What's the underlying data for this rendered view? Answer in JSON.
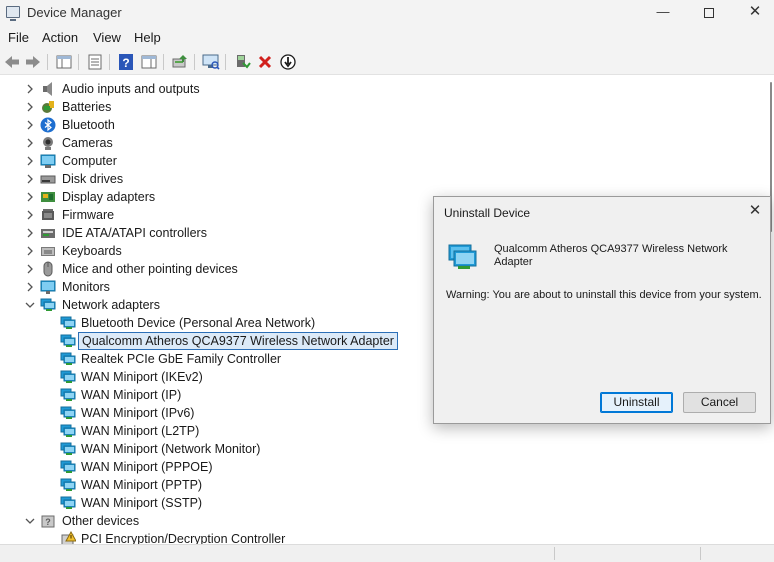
{
  "window": {
    "title": "Device Manager",
    "minimize": "—",
    "close": "✕"
  },
  "menu": [
    "File",
    "Action",
    "View",
    "Help"
  ],
  "toolbar_icons": [
    "back-arrow-icon",
    "forward-arrow-icon",
    "show-hide-tree-icon",
    "properties-icon",
    "help-icon",
    "action-pane-icon",
    "update-driver-icon",
    "scan-hardware-icon",
    "enable-device-icon",
    "uninstall-device-icon",
    "disable-device-icon"
  ],
  "tree": {
    "categories_collapsed": [
      {
        "label": "Audio inputs and outputs",
        "icon": "speaker-icon"
      },
      {
        "label": "Batteries",
        "icon": "battery-icon"
      },
      {
        "label": "Bluetooth",
        "icon": "bluetooth-icon"
      },
      {
        "label": "Cameras",
        "icon": "camera-icon"
      },
      {
        "label": "Computer",
        "icon": "computer-icon"
      },
      {
        "label": "Disk drives",
        "icon": "disk-drive-icon"
      },
      {
        "label": "Display adapters",
        "icon": "display-adapter-icon"
      },
      {
        "label": "Firmware",
        "icon": "firmware-icon"
      },
      {
        "label": "IDE ATA/ATAPI controllers",
        "icon": "ide-controller-icon"
      },
      {
        "label": "Keyboards",
        "icon": "keyboard-icon"
      },
      {
        "label": "Mice and other pointing devices",
        "icon": "mouse-icon"
      },
      {
        "label": "Monitors",
        "icon": "monitor-icon"
      }
    ],
    "network_adapters": {
      "label": "Network adapters",
      "children": [
        "Bluetooth Device (Personal Area Network)",
        "Qualcomm Atheros QCA9377 Wireless Network Adapter",
        "Realtek PCIe GbE Family Controller",
        "WAN Miniport (IKEv2)",
        "WAN Miniport (IP)",
        "WAN Miniport (IPv6)",
        "WAN Miniport (L2TP)",
        "WAN Miniport (Network Monitor)",
        "WAN Miniport (PPPOE)",
        "WAN Miniport (PPTP)",
        "WAN Miniport (SSTP)"
      ],
      "selected_index": 1
    },
    "other_devices": {
      "label": "Other devices",
      "children": [
        "PCI Encryption/Decryption Controller"
      ]
    }
  },
  "dialog": {
    "title": "Uninstall Device",
    "close": "✕",
    "device_name": "Qualcomm Atheros QCA9377 Wireless Network Adapter",
    "warning": "Warning: You are about to uninstall this device from your system.",
    "uninstall_label": "Uninstall",
    "cancel_label": "Cancel"
  },
  "colors": {
    "selection_border": "#2c6fb7",
    "selection_fill": "#dceaf8",
    "network_icon": "#1f9ad6",
    "accent_button": "#0078d7"
  }
}
